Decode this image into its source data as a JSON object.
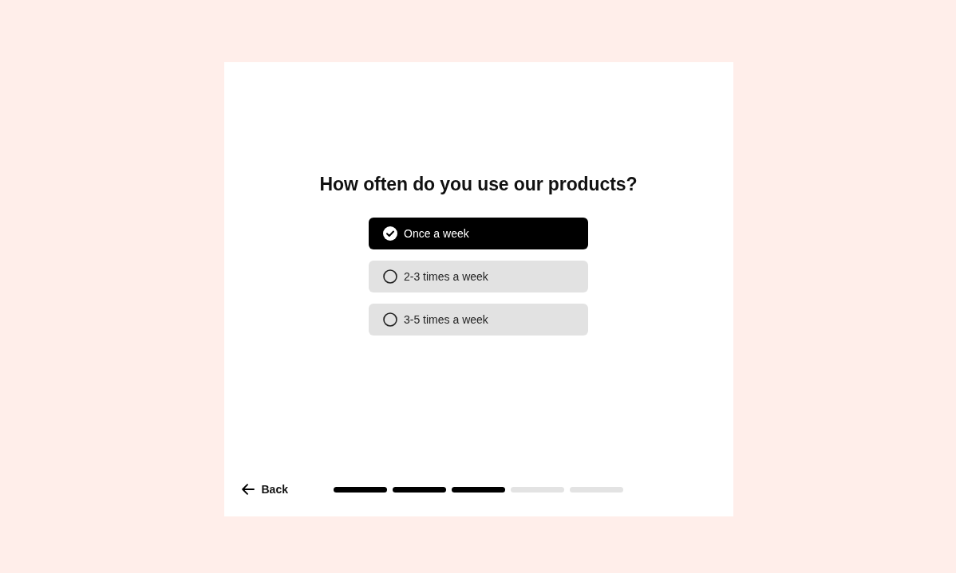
{
  "question": {
    "title": "How often do you use our products?"
  },
  "options": [
    {
      "label": "Once a week",
      "selected": true
    },
    {
      "label": "2-3 times a week",
      "selected": false
    },
    {
      "label": "3-5 times a week",
      "selected": false
    }
  ],
  "footer": {
    "back": {
      "label": "Back"
    },
    "progress": [
      {
        "completed": true
      },
      {
        "completed": true
      },
      {
        "completed": true
      },
      {
        "completed": false
      },
      {
        "completed": false
      }
    ]
  }
}
